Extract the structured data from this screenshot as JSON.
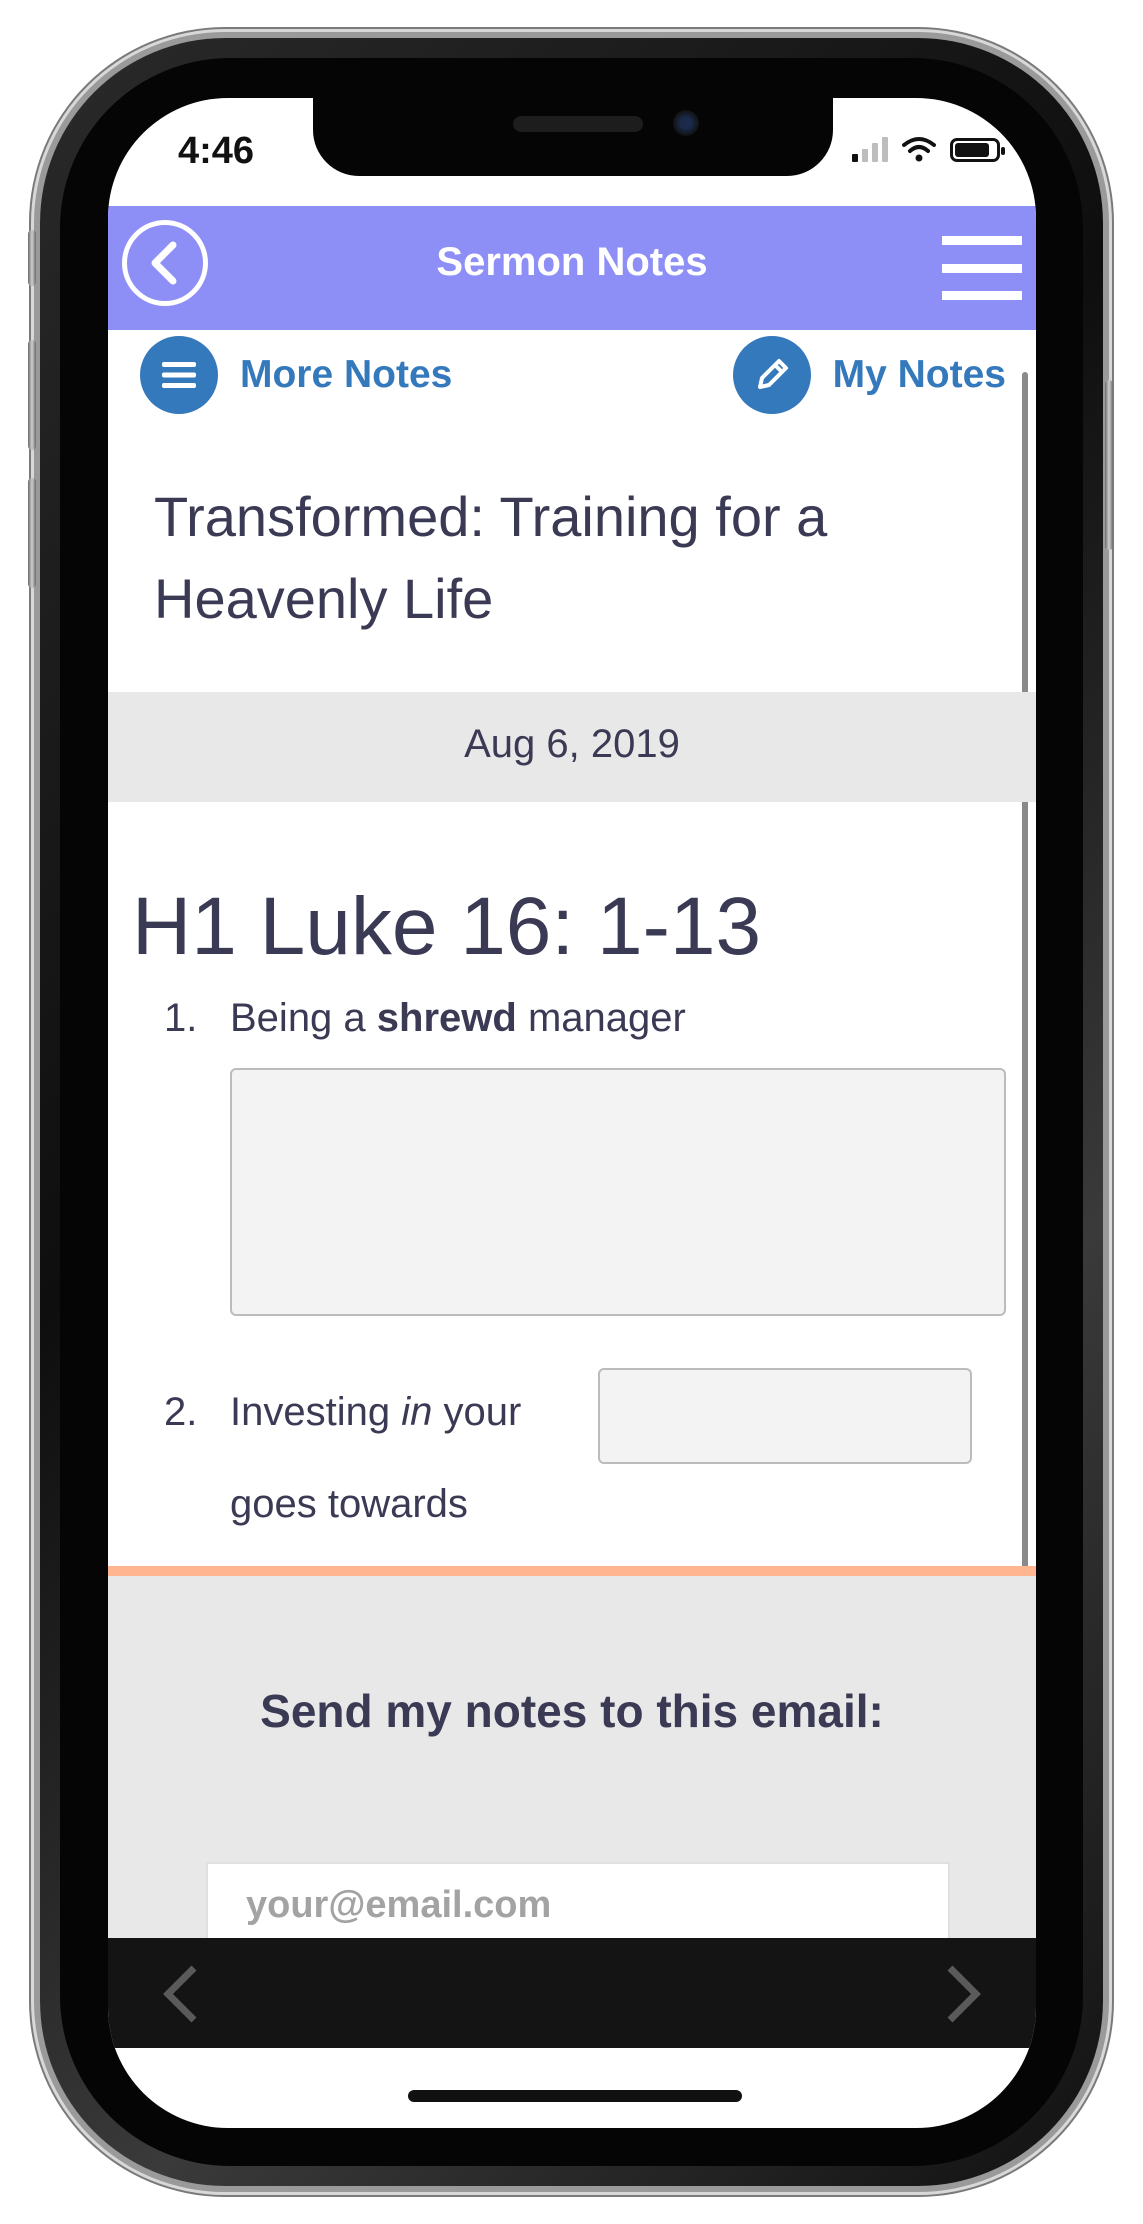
{
  "status_bar": {
    "time": "4:46"
  },
  "header": {
    "title": "Sermon Notes"
  },
  "subnav": {
    "more_notes": "More Notes",
    "my_notes": "My Notes"
  },
  "sermon": {
    "title": "Transformed: Training for a Heavenly Life",
    "date": "Aug 6, 2019",
    "heading": "H1 Luke 16: 1-13",
    "items": [
      {
        "number": "1.",
        "before": "Being a ",
        "bold": "shrewd",
        "after": " manager"
      },
      {
        "number": "2.",
        "before": "Investing ",
        "italic": "in",
        "after": " your",
        "continuation": "goes towards"
      }
    ]
  },
  "email": {
    "heading": "Send my notes to this email:",
    "placeholder": "your@email.com"
  },
  "colors": {
    "header_bg": "#8d8ff7",
    "accent_blue": "#3579bd",
    "divider_orange": "#ffb58f",
    "text_dark": "#3b3a55"
  },
  "icons": {
    "back": "chevron-left-circle-icon",
    "menu": "hamburger-menu-icon",
    "more_notes": "list-icon",
    "my_notes": "pencil-icon",
    "prev": "chevron-left-icon",
    "next": "chevron-right-icon"
  }
}
